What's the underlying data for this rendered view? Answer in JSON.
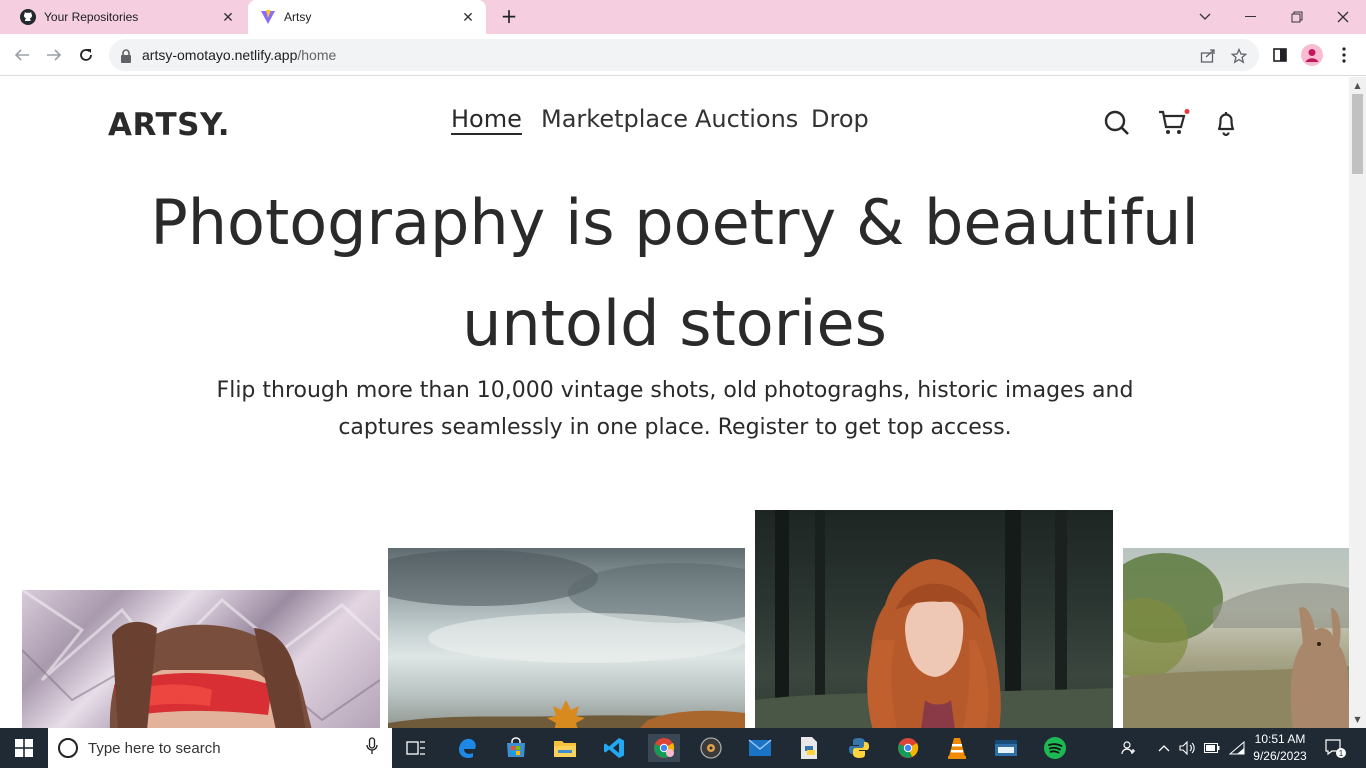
{
  "browser": {
    "tabs": [
      {
        "title": "Your Repositories",
        "icon": "github-icon",
        "active": false
      },
      {
        "title": "Artsy",
        "icon": "vite-icon",
        "active": true
      }
    ],
    "address": {
      "host": "artsy-omotayo.netlify.app",
      "path": "/home"
    }
  },
  "site": {
    "logo": "ARTSY.",
    "nav": [
      "Home",
      "Marketplace",
      "Auctions",
      "Drop"
    ],
    "hero_title_line1": "Photography is poetry & beautiful",
    "hero_title_line2": "untold stories",
    "hero_sub_line1": "Flip through more than 10,000 vintage shots, old photograghs, historic images and",
    "hero_sub_line2": "captures seamlessly in one place. Register to get top access.",
    "photos": [
      "person-with-red-goggles",
      "autumn-leaf-under-cloudy-sky",
      "red-haired-girl-in-forest",
      "kangaroo-in-field"
    ]
  },
  "taskbar": {
    "search_placeholder": "Type here to search",
    "time": "10:51 AM",
    "date": "9/26/2023",
    "notification_count": "1"
  },
  "colors": {
    "tab_strip": "#f5cfe0",
    "text": "#2a2a2a",
    "taskbar": "#1f2a35",
    "cart_dot": "#e53935"
  }
}
